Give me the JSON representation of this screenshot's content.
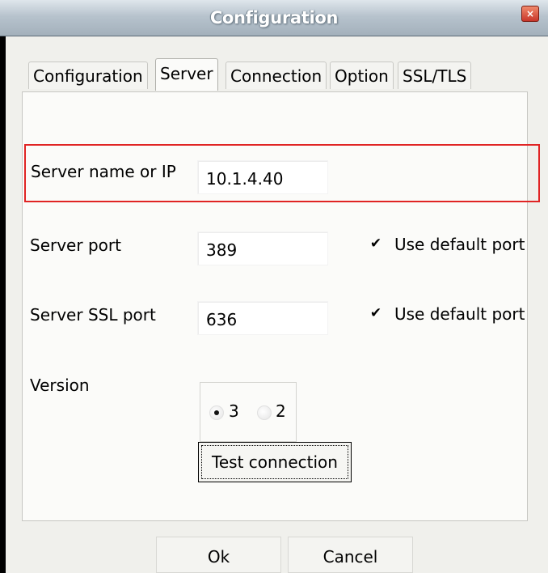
{
  "window": {
    "title": "Configuration",
    "close_label": "×"
  },
  "tabs": [
    {
      "label": "Configuration",
      "active": false
    },
    {
      "label": "Server",
      "active": true
    },
    {
      "label": "Connection",
      "active": false
    },
    {
      "label": "Option",
      "active": false
    },
    {
      "label": "SSL/TLS",
      "active": false
    }
  ],
  "server": {
    "name_label": "Server name or IP",
    "name_value": "10.1.4.40",
    "port_label": "Server port",
    "port_value": "389",
    "port_default_label": "Use default port",
    "port_default_checked": true,
    "ssl_port_label": "Server SSL port",
    "ssl_port_value": "636",
    "ssl_port_default_label": "Use default port",
    "ssl_port_default_checked": true,
    "version_label": "Version",
    "version_options": [
      {
        "label": "3",
        "selected": true
      },
      {
        "label": "2",
        "selected": false
      }
    ],
    "test_button_label": "Test connection"
  },
  "footer": {
    "ok_label": "Ok",
    "cancel_label": "Cancel"
  },
  "colors": {
    "highlight": "#e02424",
    "dialog_bg": "#f0f0ec"
  },
  "icons": {
    "close": "close-icon",
    "check": "checkmark-icon"
  }
}
